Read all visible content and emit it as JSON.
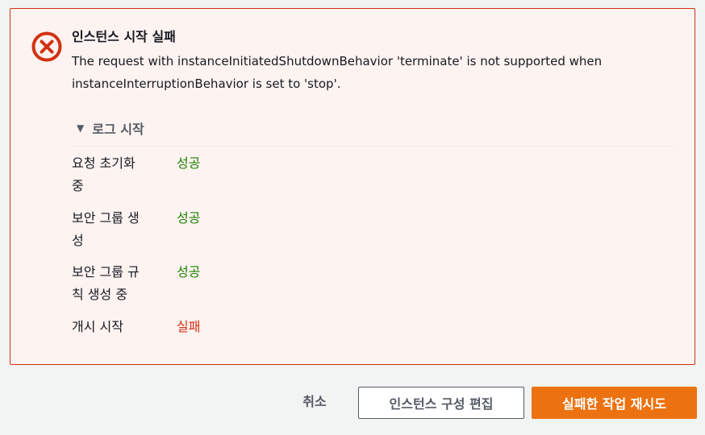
{
  "alert": {
    "type": "error",
    "icon": "error-circle-icon",
    "title": "인스턴스 시작 실패",
    "message": "The request with instanceInitiatedShutdownBehavior 'terminate' is not supported when instanceInterruptionBehavior is set to 'stop'."
  },
  "log": {
    "toggle_label": "로그 시작",
    "expanded": true,
    "steps": [
      {
        "label_line1": "요청 초기화",
        "label_line2": "중",
        "status": "성공",
        "state": "success"
      },
      {
        "label_line1": "보안 그룹 생",
        "label_line2": "성",
        "status": "성공",
        "state": "success"
      },
      {
        "label_line1": "보안 그룹 규",
        "label_line2": "칙 생성 중",
        "status": "성공",
        "state": "success"
      },
      {
        "label_line1": "개시 시작",
        "label_line2": "",
        "status": "실패",
        "state": "failure"
      }
    ]
  },
  "actions": {
    "cancel_label": "취소",
    "edit_label": "인스턴스 구성 편집",
    "retry_label": "실패한 작업 재시도"
  },
  "colors": {
    "error": "#d13212",
    "success": "#1d8102",
    "primary": "#ec7211",
    "alert_bg": "#fdf3f1"
  }
}
